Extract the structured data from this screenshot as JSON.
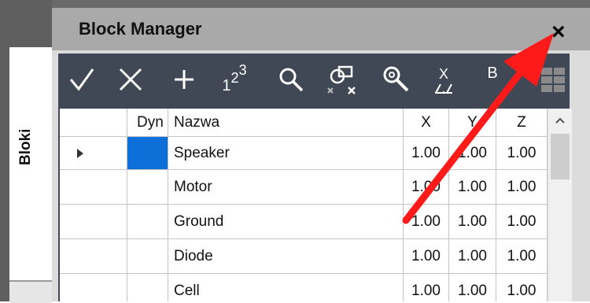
{
  "palette": {
    "title": "Block Manager",
    "side_tab_label": "Bloki",
    "close_label": "×"
  },
  "toolbar": {
    "buttons": [
      {
        "icon": "checkmark-icon"
      },
      {
        "icon": "close-x-icon"
      },
      {
        "icon": "plus-icon"
      },
      {
        "icon": "numbering-icon",
        "text_main": "1",
        "text_sup": "2",
        "text_sup2": "3"
      },
      {
        "icon": "search-icon"
      },
      {
        "icon": "block-delete-icon"
      },
      {
        "icon": "zoom-to-icon"
      },
      {
        "icon": "x-scale-icon",
        "text": "X"
      },
      {
        "icon": "b-replace-icon",
        "text": "B"
      },
      {
        "icon": "grid-view-icon"
      }
    ]
  },
  "grid": {
    "columns": [
      "",
      "Dyn",
      "Nazwa",
      "X",
      "Y",
      "Z"
    ],
    "rows": [
      {
        "name": "Speaker",
        "x": "1.00",
        "y": "1.00",
        "z": "1.00",
        "dynamic": true,
        "current": true
      },
      {
        "name": "Motor",
        "x": "1.00",
        "y": "1.00",
        "z": "1.00",
        "dynamic": false,
        "current": false
      },
      {
        "name": "Ground",
        "x": "1.00",
        "y": "1.00",
        "z": "1.00",
        "dynamic": false,
        "current": false
      },
      {
        "name": "Diode",
        "x": "1.00",
        "y": "1.00",
        "z": "1.00",
        "dynamic": false,
        "current": false
      },
      {
        "name": "Cell",
        "x": "1.00",
        "y": "1.00",
        "z": "1.00",
        "dynamic": false,
        "current": false
      }
    ]
  },
  "colors": {
    "toolbar_bg": "#404755",
    "selection_blue": "#0d70d8",
    "annotation_arrow": "#ff1a1a"
  }
}
